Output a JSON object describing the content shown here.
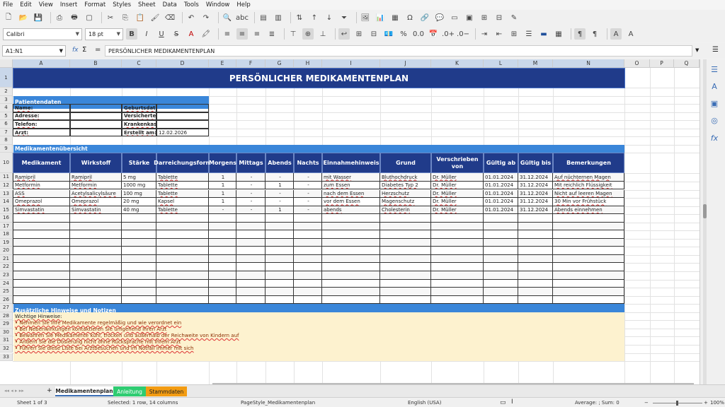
{
  "menu": [
    "File",
    "Edit",
    "View",
    "Insert",
    "Format",
    "Styles",
    "Sheet",
    "Data",
    "Tools",
    "Window",
    "Help"
  ],
  "font_name": "Calibri",
  "font_size": "18 pt",
  "name_box": "A1:N1",
  "formula": "PERSÖNLICHER MEDIKAMENTENPLAN",
  "columns": [
    "A",
    "B",
    "C",
    "D",
    "E",
    "F",
    "G",
    "H",
    "I",
    "J",
    "K",
    "L",
    "M",
    "N",
    "O",
    "P",
    "Q"
  ],
  "rows": [
    "1",
    "2",
    "3",
    "4",
    "5",
    "6",
    "7",
    "8",
    "9",
    "10",
    "11",
    "12",
    "13",
    "14",
    "15",
    "16",
    "17",
    "18",
    "19",
    "20",
    "21",
    "22",
    "23",
    "24",
    "25",
    "26",
    "27",
    "28",
    "29",
    "30",
    "31",
    "32",
    "33"
  ],
  "title": "PERSÖNLICHER MEDIKAMENTENPLAN",
  "patient": {
    "section": "Patientendaten",
    "name_label": "Name:",
    "address_label": "Adresse:",
    "phone_label": "Telefon:",
    "doctor_label": "Arzt:",
    "birth_label": "Geburtsdatum:",
    "insurance_no_label": "Versicherten-Nr.:",
    "insurance_label": "Krankenkasse:",
    "created_label": "Erstellt am:",
    "created_value": "12.02.2026"
  },
  "overview_section": "Medikamentenübersicht",
  "table_headers": [
    "Medikament",
    "Wirkstoff",
    "Stärke",
    "Darreichungsform",
    "Morgens",
    "Mittags",
    "Abends",
    "Nachts",
    "Einnahmehinweis",
    "Grund",
    "Verschrieben von",
    "Gültig ab",
    "Gültig bis",
    "Bemerkungen"
  ],
  "table_rows": [
    [
      "Ramipril",
      "Ramipril",
      "5 mg",
      "Tablette",
      "1",
      "-",
      "-",
      "-",
      "mit Wasser",
      "Bluthochdruck",
      "Dr. Müller",
      "01.01.2024",
      "31.12.2024",
      "Auf nüchternen Magen"
    ],
    [
      "Metformin",
      "Metformin",
      "1000 mg",
      "Tablette",
      "1",
      "-",
      "1",
      "-",
      "zum Essen",
      "Diabetes Typ 2",
      "Dr. Müller",
      "01.01.2024",
      "31.12.2024",
      "Mit reichlich Flüssigkeit"
    ],
    [
      "ASS",
      "Acetylsalicylsäure",
      "100 mg",
      "Tablette",
      "1",
      "-",
      "-",
      "-",
      "nach dem Essen",
      "Herzschutz",
      "Dr. Müller",
      "01.01.2024",
      "31.12.2024",
      "Nicht auf leeren Magen"
    ],
    [
      "Omeprazol",
      "Omeprazol",
      "20 mg",
      "Kapsel",
      "1",
      "-",
      "-",
      "-",
      "vor dem Essen",
      "Magenschutz",
      "Dr. Müller",
      "01.01.2024",
      "31.12.2024",
      "30 Min vor Frühstück"
    ],
    [
      "Simvastatin",
      "Simvastatin",
      "40 mg",
      "Tablette",
      "-",
      "-",
      "1",
      "-",
      "abends",
      "Cholesterin",
      "Dr. Müller",
      "01.01.2024",
      "31.12.2024",
      "Abends einnehmen"
    ]
  ],
  "notes_section": "Zusätzliche Hinweise und Notizen",
  "notes": [
    "Wichtige Hinweise:",
    "• Nehmen Sie Ihre Medikamente regelmäßig und wie verordnet ein",
    "• Bei Nebenwirkungen kontaktieren Sie umgehend Ihren Arzt",
    "• Bewahren Sie Medikamente kühl, trocken und außerhalb der Reichweite von Kindern auf",
    "• Ändern Sie die Dosierung nicht ohne Rücksprache mit Ihrem Arzt",
    "• Führen Sie diese Liste bei Arztbesuchen und im Notfall immer mit sich"
  ],
  "tabs": [
    {
      "label": "Medikamentenplan",
      "color": "#ffffff"
    },
    {
      "label": "Anleitung",
      "color": "#2ecc71"
    },
    {
      "label": "Stammdaten",
      "color": "#f39c12"
    }
  ],
  "status": {
    "sheet": "Sheet 1 of 3",
    "selection": "Selected: 1 row, 14 columns",
    "pagestyle": "PageStyle_Medikamentenplan",
    "language": "English (USA)",
    "sum": "Average: ; Sum: 0",
    "zoom": "100%"
  }
}
